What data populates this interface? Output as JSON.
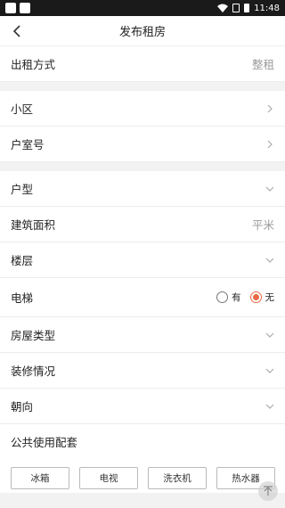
{
  "statusbar": {
    "time": "11:48"
  },
  "navbar": {
    "title": "发布租房"
  },
  "rent_mode": {
    "label": "出租方式",
    "value": "整租"
  },
  "community": {
    "label": "小区"
  },
  "room_number": {
    "label": "户室号"
  },
  "layout": {
    "label": "户型"
  },
  "area": {
    "label": "建筑面积",
    "placeholder": "平米"
  },
  "floor": {
    "label": "楼层"
  },
  "elevator": {
    "label": "电梯",
    "options": [
      "有",
      "无"
    ],
    "selected": "无"
  },
  "house_type": {
    "label": "房屋类型"
  },
  "decoration": {
    "label": "装修情况"
  },
  "orientation": {
    "label": "朝向"
  },
  "facilities": {
    "title": "公共使用配套",
    "items": [
      "冰箱",
      "电视",
      "洗衣机",
      "热水器"
    ]
  },
  "colors": {
    "accent": "#e86b45"
  }
}
